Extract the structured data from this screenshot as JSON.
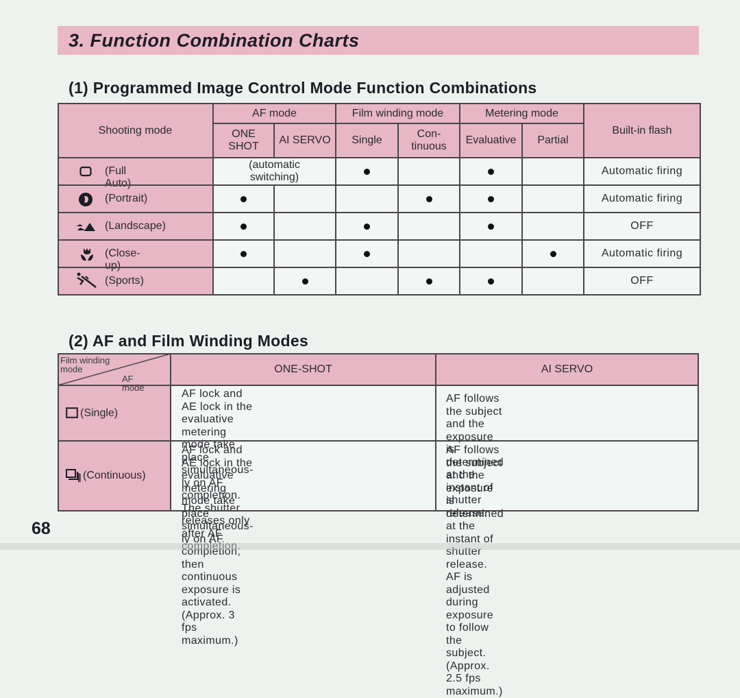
{
  "page": {
    "title": "3. Function Combination Charts",
    "page_number": "68",
    "colors": {
      "header_pink": "#e7b7c5",
      "cell_light": "#f2f6f4",
      "text": "#1d1d26",
      "rule": "#4a4648"
    }
  },
  "section1": {
    "heading": "(1) Programmed Image Control Mode Function Combinations",
    "headers": {
      "shooting_mode": "Shooting mode",
      "af_mode": "AF mode",
      "one_shot": "ONE SHOT",
      "ai_servo": "AI SERVO",
      "film_winding_mode": "Film winding mode",
      "single": "Single",
      "continuous": "Con- tinuous",
      "metering_mode": "Metering mode",
      "evaluative": "Evaluative",
      "partial": "Partial",
      "built_in_flash": "Built-in flash"
    },
    "rows": [
      {
        "icon": "full-auto-icon",
        "mode": "(Full Auto)",
        "af_note": "(automatic switching)",
        "one_shot": false,
        "ai_servo": false,
        "single": true,
        "continuous": false,
        "evaluative": true,
        "partial": false,
        "flash": "Automatic firing"
      },
      {
        "icon": "portrait-icon",
        "mode": "(Portrait)",
        "one_shot": true,
        "ai_servo": false,
        "single": false,
        "continuous": true,
        "evaluative": true,
        "partial": false,
        "flash": "Automatic firing"
      },
      {
        "icon": "landscape-icon",
        "mode": "(Landscape)",
        "one_shot": true,
        "ai_servo": false,
        "single": true,
        "continuous": false,
        "evaluative": true,
        "partial": false,
        "flash": "OFF"
      },
      {
        "icon": "close-up-icon",
        "mode": "(Close-up)",
        "one_shot": true,
        "ai_servo": false,
        "single": true,
        "continuous": false,
        "evaluative": false,
        "partial": true,
        "flash": "Automatic firing"
      },
      {
        "icon": "sports-icon",
        "mode": "(Sports)",
        "one_shot": false,
        "ai_servo": true,
        "single": false,
        "continuous": true,
        "evaluative": true,
        "partial": false,
        "flash": "OFF"
      }
    ]
  },
  "section2": {
    "heading": "(2) AF and Film Winding Modes",
    "corner": {
      "row_label": "Film winding mode",
      "col_label": "AF mode"
    },
    "columns": [
      "ONE-SHOT",
      "AI SERVO"
    ],
    "rows": [
      {
        "icon": "single-frame-icon",
        "mode": "(Single)",
        "one_shot_lines": [
          "AF lock and AE lock in the evaluative",
          "metering mode take place simultaneous-",
          "ly on AF completion. The shutter",
          "releases only after AF completion."
        ],
        "ai_servo_lines": [
          "AF follows the subject and the exposure",
          "is determined at the instant of shutter",
          "release."
        ]
      },
      {
        "icon": "continuous-frame-icon",
        "mode": "(Continuous)",
        "one_shot_lines": [
          "AF lock and AE lock in the evaluative",
          "metering mode take place simultaneous-",
          "ly on AF completion, then continuous",
          "exposure is activated. (Approx. 3 fps",
          "maximum.)"
        ],
        "ai_servo_lines": [
          "AF follows the subject and the exposure",
          "is determined at the instant of shutter",
          "release. AF is adjusted during exposure",
          "to follow the subject. (Approx. 2.5 fps",
          "maximum.)"
        ]
      }
    ]
  }
}
